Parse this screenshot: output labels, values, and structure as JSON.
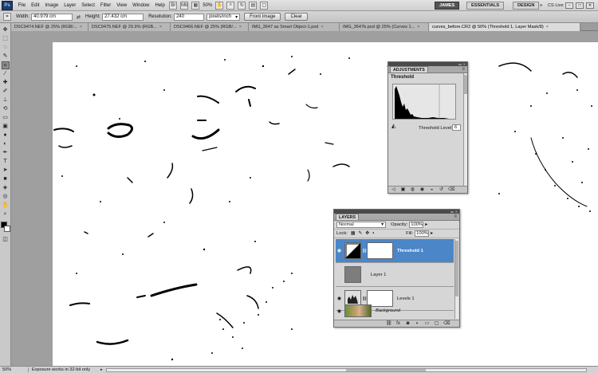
{
  "menubar": {
    "logo": "Ps",
    "items": [
      "File",
      "Edit",
      "Image",
      "Layer",
      "Select",
      "Filter",
      "View",
      "Window",
      "Help"
    ],
    "zoom": "50%",
    "workspaces": [
      "JAMES",
      "ESSENTIALS",
      "DESIGN"
    ],
    "more": "»",
    "cslive": "CS Live"
  },
  "options": {
    "width_label": "Width:",
    "width_value": "40.979 cm",
    "height_label": "Height:",
    "height_value": "27.432 cm",
    "resolution_label": "Resolution:",
    "resolution_value": "240",
    "unit": "pixels/inch",
    "front_image": "Front Image",
    "clear": "Clear"
  },
  "tabs": [
    {
      "label": "DSC9474.NEF @ 25% (RGB/..."
    },
    {
      "label": "DSC9475.NEF @ 29.9% (RGB..."
    },
    {
      "label": "DSC9466.NEF @ 25% (RGB/..."
    },
    {
      "label": "IMG_3647 as Smart Object-1.psd"
    },
    {
      "label": "IMG_3647b.psd @ 25% (Curves 1..."
    },
    {
      "label": "curves_before.CR2 @ 50% (Threshold 1, Layer Mask/8)"
    }
  ],
  "status": {
    "zoom": "50%",
    "text": "Exposure works in 32-bit only"
  },
  "adjustments": {
    "tab": "ADJUSTMENTS",
    "title": "Threshold",
    "level_label": "Threshold Level:",
    "level_value": "6"
  },
  "layers_panel": {
    "tab": "LAYERS",
    "blend_mode": "Normal",
    "opacity_label": "Opacity:",
    "opacity_value": "100%",
    "lock_label": "Lock:",
    "fill_label": "Fill:",
    "fill_value": "100%",
    "layers": [
      {
        "name": "Threshold 1",
        "selected": true
      },
      {
        "name": "Layer 1",
        "selected": false
      },
      {
        "name": "Levels 1",
        "selected": false
      },
      {
        "name": "Background",
        "selected": false
      }
    ]
  },
  "colors": {
    "selected_layer": "#4a86c8",
    "active_workspace": "#555555"
  }
}
